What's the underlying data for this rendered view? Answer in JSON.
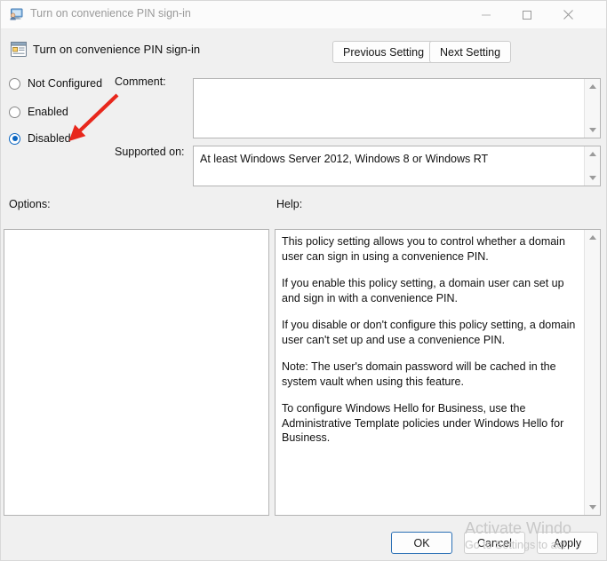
{
  "window": {
    "title": "Turn on convenience PIN sign-in",
    "icon": "policy-monitor-icon",
    "controls": {
      "minimize": "minimize-icon",
      "maximize": "maximize-icon",
      "close": "close-icon"
    }
  },
  "header": {
    "icon": "policy-setting-icon",
    "title": "Turn on convenience PIN sign-in",
    "previous_setting": "Previous Setting",
    "next_setting": "Next Setting"
  },
  "state": {
    "options": [
      {
        "id": "not-configured",
        "label": "Not Configured",
        "selected": false
      },
      {
        "id": "enabled",
        "label": "Enabled",
        "selected": false
      },
      {
        "id": "disabled",
        "label": "Disabled",
        "selected": true
      }
    ],
    "selected_value": "Disabled"
  },
  "comment": {
    "label": "Comment:",
    "value": "",
    "placeholder": ""
  },
  "supported": {
    "label": "Supported on:",
    "value": "At least Windows Server 2012, Windows 8 or Windows RT"
  },
  "options_panel": {
    "label": "Options:",
    "content": ""
  },
  "help_panel": {
    "label": "Help:",
    "paragraphs": [
      "This policy setting allows you to control whether a domain user can sign in using a convenience PIN.",
      "If you enable this policy setting, a domain user can set up and sign in with a convenience PIN.",
      "If you disable or don't configure this policy setting, a domain user can't set up and use a convenience PIN.",
      "Note: The user's domain password will be cached in the system vault when using this feature.",
      "To configure Windows Hello for Business, use the Administrative Template policies under Windows Hello for Business."
    ]
  },
  "footer": {
    "ok": "OK",
    "cancel": "Cancel",
    "apply": "Apply"
  },
  "watermark": {
    "line1": "Activate Windo",
    "line2": "Go to Settings to act"
  },
  "annotation": {
    "type": "red-arrow",
    "color": "#e8271c",
    "points_to": "Disabled"
  },
  "colors": {
    "accent": "#0a65c1",
    "dialog_bg": "#f0f0f0",
    "titlebar_bg": "#fbfbfb",
    "field_bg": "#ffffff",
    "annotation_red": "#e8271c"
  }
}
